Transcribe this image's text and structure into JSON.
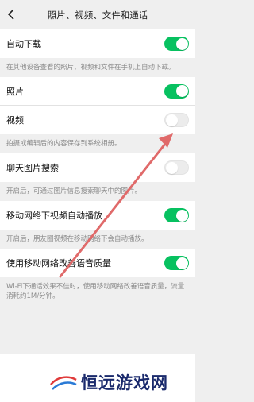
{
  "header": {
    "title": "照片、视频、文件和通话"
  },
  "settings": [
    {
      "label": "自动下载",
      "on": true,
      "note": "在其他设备查看的照片、视频和文件在手机上自动下载。"
    },
    {
      "label": "照片",
      "on": true
    },
    {
      "label": "视频",
      "on": false,
      "note": "拍摄或编辑后的内容保存到系统相册。"
    },
    {
      "label": "聊天图片搜索",
      "on": false,
      "note": "开启后，可通过图片信息搜索聊天中的图片。"
    },
    {
      "label": "移动网络下视频自动播放",
      "on": true,
      "note": "开启后，朋友圈视频在移动网络下会自动播放。"
    },
    {
      "label": "使用移动网络改善语音质量",
      "on": true,
      "note": "Wi-Fi下通话效果不佳时，使用移动网络改善语音质量，流量消耗约1M/分钟。"
    }
  ],
  "watermark": {
    "text": "恒远游戏网"
  },
  "colors": {
    "toggle_on": "#07c160",
    "arrow": "#e06a6a"
  }
}
